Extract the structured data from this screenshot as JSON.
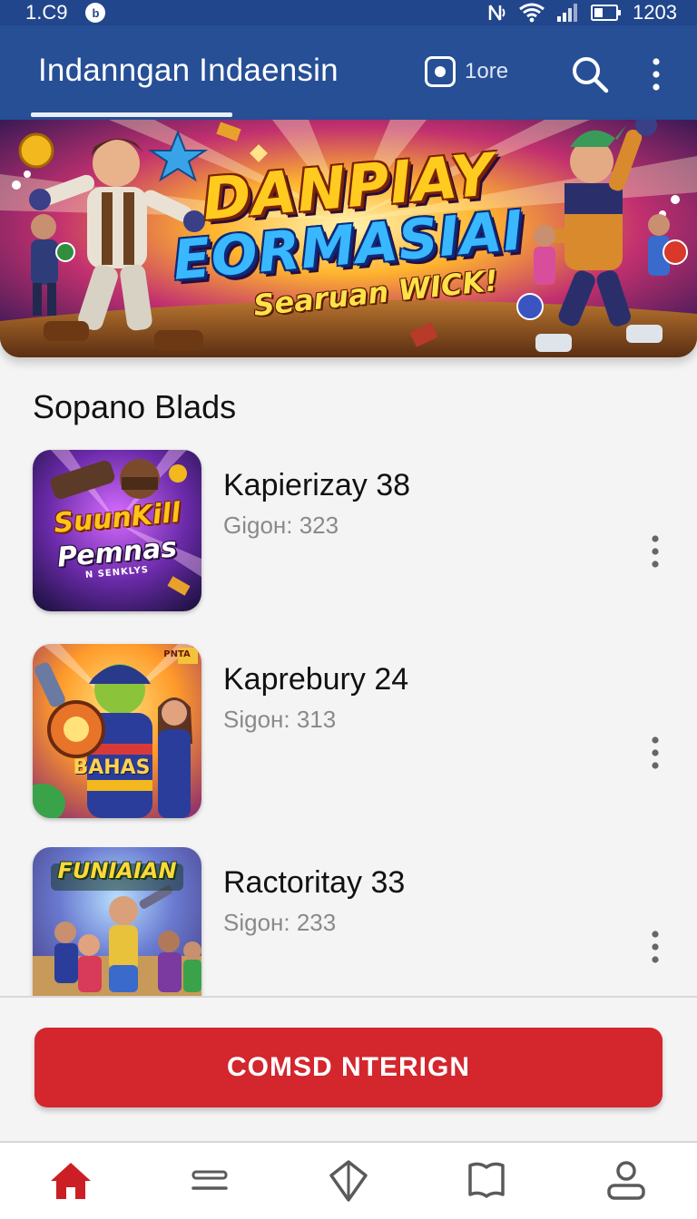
{
  "status_bar": {
    "time": "1.C9",
    "notification_badge": "b",
    "battery_text": "1203",
    "icons": [
      "nfc-icon",
      "wifi-icon",
      "signal-icon",
      "battery-icon"
    ]
  },
  "app_bar": {
    "title": "Indanngan Indaensin",
    "chip_label": "1ore",
    "icons": [
      "camera-icon",
      "search-icon",
      "more-vert-icon"
    ]
  },
  "hero": {
    "line1": "DANPIAY",
    "line2": "EORMASIAI",
    "tagline": "Searuan WICK!"
  },
  "section": {
    "title": "Sopano Blads"
  },
  "games": [
    {
      "name": "Kapierizay 38",
      "meta": "Gigoн: 323",
      "thumb_line1": "SuunKill",
      "thumb_line2": "Pemnas",
      "thumb_small": "N SENKLYS"
    },
    {
      "name": "Kaprebury 24",
      "meta": "Sigoн: 313",
      "thumb_line1": "BAHAS",
      "thumb_line2": "",
      "thumb_small": "PNTA"
    },
    {
      "name": "Ractoritay 33",
      "meta": "Sigoн: 233",
      "thumb_line1": "FUNIAIAN",
      "thumb_line2": "",
      "thumb_small": ""
    }
  ],
  "action": {
    "button_label": "COMSD NTERIGN"
  },
  "bottom_nav": {
    "items": [
      "home-icon",
      "list-icon",
      "diamond-icon",
      "book-icon",
      "profile-icon"
    ],
    "active_color": "#cc1f25",
    "inactive_color": "#5a5a5a"
  },
  "colors": {
    "primary": "#264f96",
    "status_bar": "#21468c",
    "accent_red": "#d3262d"
  }
}
